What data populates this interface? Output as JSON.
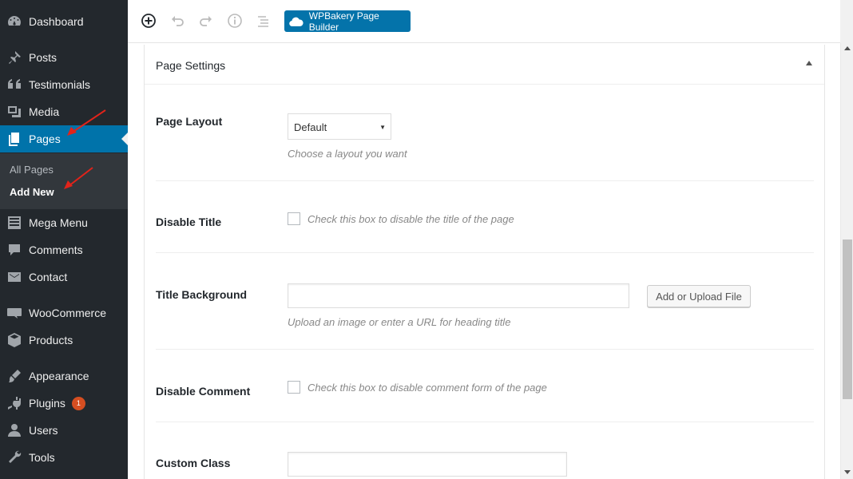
{
  "sidebar": {
    "items": [
      {
        "label": "Dashboard",
        "icon": "dashboard-icon"
      },
      {
        "label": "Posts",
        "icon": "pin-icon"
      },
      {
        "label": "Testimonials",
        "icon": "quote-icon"
      },
      {
        "label": "Media",
        "icon": "media-icon"
      },
      {
        "label": "Pages",
        "icon": "pages-icon"
      },
      {
        "label": "Mega Menu",
        "icon": "list-icon"
      },
      {
        "label": "Comments",
        "icon": "comment-icon"
      },
      {
        "label": "Contact",
        "icon": "mail-icon"
      },
      {
        "label": "WooCommerce",
        "icon": "woocommerce-icon"
      },
      {
        "label": "Products",
        "icon": "box-icon"
      },
      {
        "label": "Appearance",
        "icon": "brush-icon"
      },
      {
        "label": "Plugins",
        "icon": "plugin-icon",
        "badge": "1"
      },
      {
        "label": "Users",
        "icon": "user-icon"
      },
      {
        "label": "Tools",
        "icon": "wrench-icon"
      }
    ],
    "submenu": [
      {
        "label": "All Pages"
      },
      {
        "label": "Add New"
      }
    ]
  },
  "toolbar": {
    "icons": [
      "add-element-icon",
      "undo-icon",
      "redo-icon",
      "info-icon",
      "outline-icon"
    ],
    "builder_label": "WPBakery Page Builder"
  },
  "settings": {
    "title": "Page Settings",
    "page_layout": {
      "label": "Page Layout",
      "value": "Default",
      "description": "Choose a layout you want"
    },
    "disable_title": {
      "label": "Disable Title",
      "description": "Check this box to disable the title of the page"
    },
    "title_background": {
      "label": "Title Background",
      "value": "",
      "button": "Add or Upload File",
      "description": "Upload an image or enter a URL for heading title"
    },
    "disable_comment": {
      "label": "Disable Comment",
      "description": "Check this box to disable comment form of the page"
    },
    "custom_class": {
      "label": "Custom Class",
      "value": ""
    }
  },
  "colors": {
    "sidebar_bg": "#23282d",
    "accent": "#0073aa",
    "badge": "#d54e21",
    "annotation": "#e2231a"
  }
}
